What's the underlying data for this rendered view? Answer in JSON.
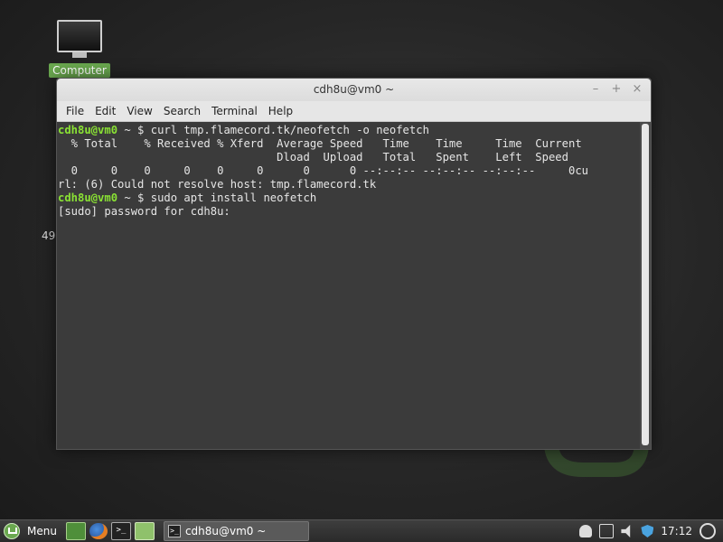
{
  "desktop": {
    "computer_icon_label": "Computer",
    "side_fragment": "49",
    "watermark_icon": "linux-mint-logo"
  },
  "window": {
    "title": "cdh8u@vm0 ~",
    "buttons": {
      "minimize": "–",
      "maximize": "+",
      "close": "×"
    },
    "menu": [
      "File",
      "Edit",
      "View",
      "Search",
      "Terminal",
      "Help"
    ]
  },
  "terminal": {
    "prompt1": "cdh8u@vm0",
    "cmd1": " ~ $ curl tmp.flamecord.tk/neofetch -o neofetch",
    "line2": "  % Total    % Received % Xferd  Average Speed   Time    Time     Time  Current",
    "line3": "                                 Dload  Upload   Total   Spent    Left  Speed",
    "line4": "  0     0    0     0    0     0      0      0 --:--:-- --:--:-- --:--:--     0cu",
    "line5": "rl: (6) Could not resolve host: tmp.flamecord.tk",
    "prompt2": "cdh8u@vm0",
    "cmd2": " ~ $ sudo apt install neofetch",
    "line7": "[sudo] password for cdh8u: "
  },
  "taskbar": {
    "menu_label": "Menu",
    "launchers": [
      "show-desktop-icon",
      "firefox-icon",
      "terminal-icon",
      "files-icon"
    ],
    "task_label": "cdh8u@vm0 ~",
    "clock": "17:12",
    "tray_icons": [
      "user-icon",
      "update-manager-icon",
      "volume-icon",
      "shield-icon",
      "power-icon"
    ]
  },
  "colors": {
    "prompt_green": "#8ae234",
    "terminal_bg": "#3b3b3b",
    "mint_green": "#6aa84f"
  }
}
